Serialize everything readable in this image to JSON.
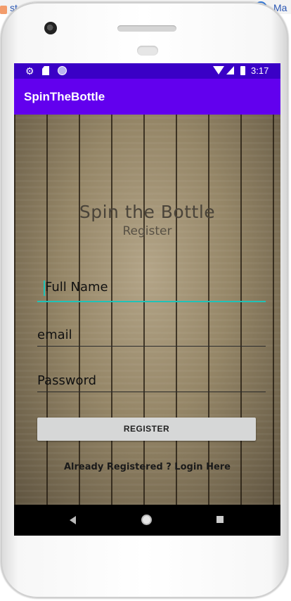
{
  "host": {
    "left_text": "st",
    "right_text": "Ma"
  },
  "status_bar": {
    "time": "3:17",
    "icons": [
      "gear-icon",
      "sd-card-icon",
      "circle-dot-icon",
      "wifi-icon",
      "signal-icon",
      "battery-icon"
    ]
  },
  "app_bar": {
    "title": "SpinTheBottle"
  },
  "heading": {
    "title": "Spin the Bottle",
    "subtitle": "Register"
  },
  "form": {
    "full_name_placeholder": "Full Name",
    "email_placeholder": "email",
    "password_placeholder": "Password",
    "register_label": "REGISTER"
  },
  "footer": {
    "login_link": "Already Registered ? Login Here"
  },
  "colors": {
    "status_bar": "#3a00c6",
    "app_bar": "#6200ee",
    "accent": "#20c2b7"
  },
  "nav_bar": {
    "icons": [
      "back-icon",
      "home-icon",
      "recents-icon"
    ]
  }
}
